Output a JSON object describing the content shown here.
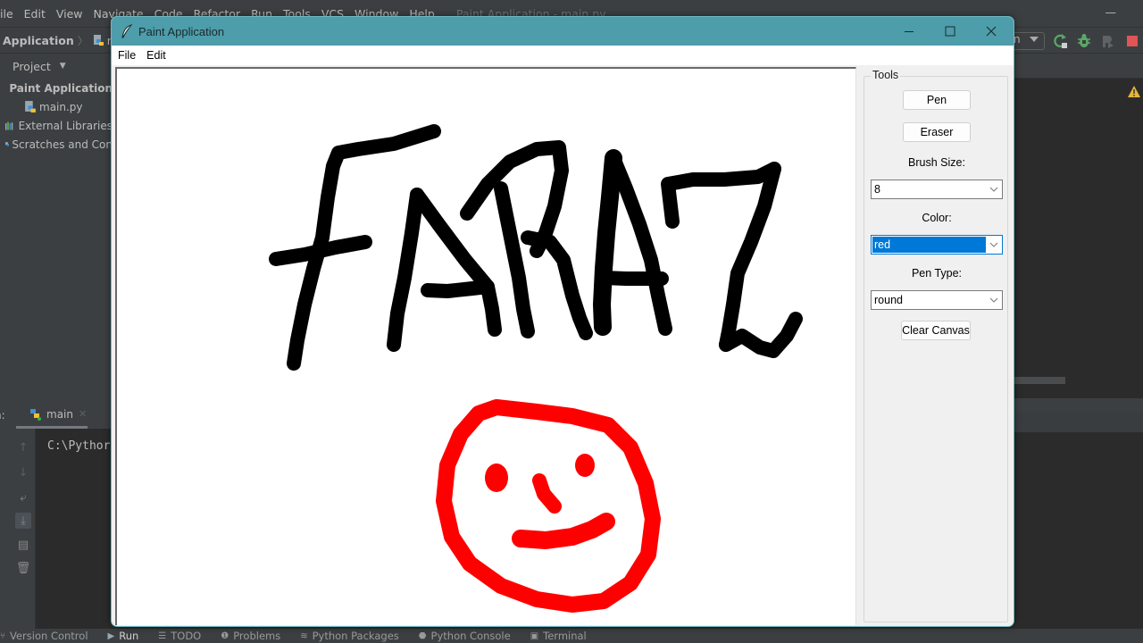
{
  "ide": {
    "menu": [
      "ile",
      "Edit",
      "View",
      "Navigate",
      "Code",
      "Refactor",
      "Run",
      "Tools",
      "VCS",
      "Window",
      "Help"
    ],
    "window_title": "Paint Application - main.py",
    "breadcrumb": {
      "project": "Application",
      "file": "mai"
    },
    "run_config": "n",
    "project_panel": {
      "header": "Project",
      "items": [
        {
          "label": "Paint Application",
          "icon": "folder-icon"
        },
        {
          "label": "main.py",
          "icon": "python-file-icon"
        },
        {
          "label": "External Libraries",
          "icon": "libraries-icon"
        },
        {
          "label": "Scratches and Con",
          "icon": "scratches-icon"
        }
      ]
    },
    "run_panel": {
      "label": "n:",
      "tab": "main",
      "console_text": "C:\\Pythor"
    },
    "status_bar": [
      {
        "label": "Version Control",
        "icon": "vcs-icon"
      },
      {
        "label": "Run",
        "icon": "run-icon",
        "active": true
      },
      {
        "label": "TODO",
        "icon": "todo-icon"
      },
      {
        "label": "Problems",
        "icon": "problems-icon"
      },
      {
        "label": "Python Packages",
        "icon": "packages-icon"
      },
      {
        "label": "Python Console",
        "icon": "python-console-icon"
      },
      {
        "label": "Terminal",
        "icon": "terminal-icon"
      }
    ]
  },
  "paint": {
    "title": "Paint Application",
    "menu": [
      "File",
      "Edit"
    ],
    "tools": {
      "legend": "Tools",
      "pen_label": "Pen",
      "eraser_label": "Eraser",
      "brush_size_label": "Brush Size:",
      "brush_size_value": "8",
      "color_label": "Color:",
      "color_value": "red",
      "pen_type_label": "Pen Type:",
      "pen_type_value": "round",
      "clear_label": "Clear Canvas"
    },
    "drawing": {
      "text_strokes_color": "#000000",
      "face_color": "#ff0000",
      "written_word": "FARAZ"
    }
  }
}
